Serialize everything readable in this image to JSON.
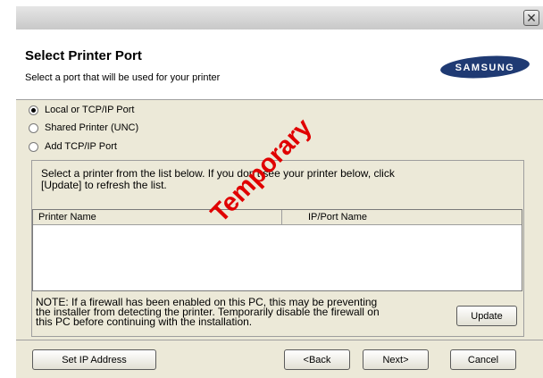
{
  "header": {
    "title": "Select Printer Port",
    "subtitle": "Select a port that will be used for your printer",
    "logo_text": "SAMSUNG"
  },
  "ports": {
    "options": [
      {
        "label": "Local or TCP/IP Port",
        "checked": true
      },
      {
        "label": "Shared Printer (UNC)",
        "checked": false
      },
      {
        "label": "Add TCP/IP Port",
        "checked": false
      }
    ]
  },
  "list_section": {
    "instruction": "Select a printer from the list below. If you don't see your printer below, click\n[Update] to refresh the list.",
    "columns": [
      "Printer Name",
      "IP/Port Name"
    ],
    "rows": []
  },
  "note": "NOTE: If a firewall has been enabled on this PC, this may be preventing\nthe installer from detecting the printer. Temporarily disable the firewall on\nthis PC before continuing with the installation.",
  "buttons": {
    "update": "Update",
    "set_ip": "Set IP Address",
    "back": "<Back",
    "next": "Next>",
    "cancel": "Cancel"
  },
  "watermark": "Temporary",
  "colors": {
    "window_bg": "#ece9d8",
    "watermark": "#e00000"
  }
}
